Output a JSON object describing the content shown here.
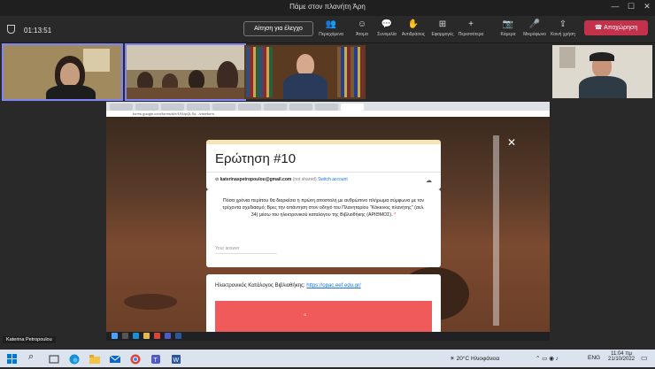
{
  "window": {
    "title": "Πάμε στον πλανήτη Άρη",
    "minimize": "—",
    "maximize": "☐",
    "close": "✕"
  },
  "toolbar": {
    "timer": "01:13:51",
    "request_control": "Αίτηση για έλεγχο",
    "items": [
      {
        "icon": "👥",
        "label": "Περιεχόμενα"
      },
      {
        "icon": "☺",
        "label": "Άτομα"
      },
      {
        "icon": "💬",
        "label": "Συνομιλία"
      },
      {
        "icon": "✋",
        "label": "Αντιδράσεις"
      },
      {
        "icon": "⊞",
        "label": "Εφαρμογές"
      },
      {
        "icon": "+",
        "label": "Περισσότερα"
      },
      {
        "icon": "📷",
        "label": "Κάμερα"
      },
      {
        "icon": "🎤",
        "label": "Μικρόφωνο"
      },
      {
        "icon": "⇪",
        "label": "Κοινή χρήση"
      }
    ],
    "leave_label": "Αποχώρηση",
    "leave_color": "#c4314b"
  },
  "browser": {
    "url": "forms.google.com/forms/d/e/1FAIpQLSd.../viewform"
  },
  "form": {
    "title": "Ερώτηση #10",
    "email": "katerinaspetropoulou@gmail.com",
    "not_shared": "(not shared)",
    "switch_account": "Switch account",
    "question": "Πόσα χρόνια περίπου θα διαρκέσει η πρώτη αποστολή με ανθρώπινο πλήρωμα σύμφωνα με τον τρέχοντα σχεδιασμό; Βρες την απάντηση στον οδηγό του Πλανηταρίου \"Κόκκινος πλανήτης\" (σελ. 34) μέσω του ηλεκτρονικού καταλόγου της Βιβλιοθήκης (ΑΡΙΘΜΟΣ).",
    "required_mark": "*",
    "answer_placeholder": "Your answer",
    "catalog_label": "Ηλεκτρονικός Κατάλογος Βιβλιοθήκης:",
    "catalog_link": "https://opac.eef.edu.gr/"
  },
  "participant_name": "Katerina Petropoulou",
  "taskbar": {
    "weather": "20°C Ηλιοφάνεια",
    "language": "ENG",
    "time": "11:04 πμ",
    "date": "21/10/2022"
  }
}
